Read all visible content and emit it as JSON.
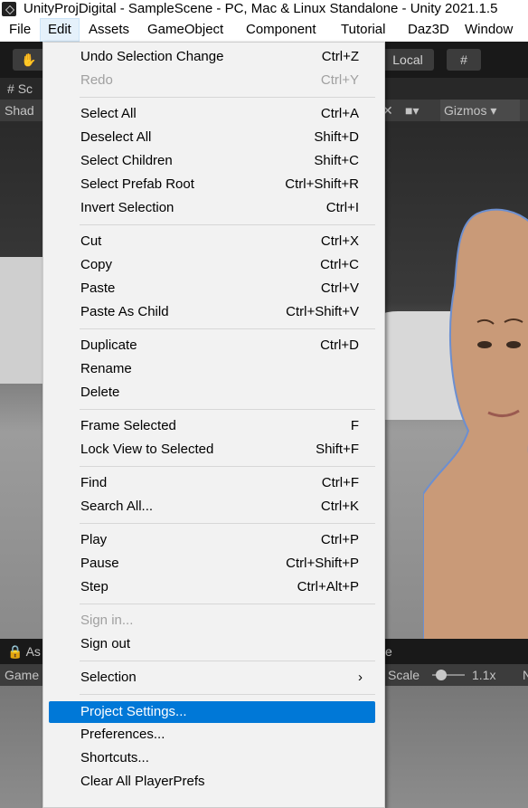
{
  "window": {
    "title": "UnityProjDigital - SampleScene - PC, Mac & Linux Standalone - Unity 2021.1.5"
  },
  "menubar": [
    "File",
    "Edit",
    "Assets",
    "GameObject",
    "Component",
    "Tutorial",
    "Daz3D",
    "Window"
  ],
  "editor": {
    "toolbar_local": "Local",
    "scene_tab": "Sc",
    "scene_shading": "Shad",
    "gizmos": "Gizmos",
    "assets_tab": "As",
    "game_tab_suffix": "e",
    "game_label": "Game",
    "scale_label": "Scale",
    "scale_value": "1.1x",
    "scale_level": 0.1
  },
  "menu": {
    "undo": {
      "label": "Undo Selection Change",
      "shortcut": "Ctrl+Z"
    },
    "redo": {
      "label": "Redo",
      "shortcut": "Ctrl+Y"
    },
    "select_all": {
      "label": "Select All",
      "shortcut": "Ctrl+A"
    },
    "deselect_all": {
      "label": "Deselect All",
      "shortcut": "Shift+D"
    },
    "select_children": {
      "label": "Select Children",
      "shortcut": "Shift+C"
    },
    "select_prefab_root": {
      "label": "Select Prefab Root",
      "shortcut": "Ctrl+Shift+R"
    },
    "invert_selection": {
      "label": "Invert Selection",
      "shortcut": "Ctrl+I"
    },
    "cut": {
      "label": "Cut",
      "shortcut": "Ctrl+X"
    },
    "copy": {
      "label": "Copy",
      "shortcut": "Ctrl+C"
    },
    "paste": {
      "label": "Paste",
      "shortcut": "Ctrl+V"
    },
    "paste_as_child": {
      "label": "Paste As Child",
      "shortcut": "Ctrl+Shift+V"
    },
    "duplicate": {
      "label": "Duplicate",
      "shortcut": "Ctrl+D"
    },
    "rename": {
      "label": "Rename",
      "shortcut": ""
    },
    "delete": {
      "label": "Delete",
      "shortcut": ""
    },
    "frame_selected": {
      "label": "Frame Selected",
      "shortcut": "F"
    },
    "lock_view": {
      "label": "Lock View to Selected",
      "shortcut": "Shift+F"
    },
    "find": {
      "label": "Find",
      "shortcut": "Ctrl+F"
    },
    "search_all": {
      "label": "Search All...",
      "shortcut": "Ctrl+K"
    },
    "play": {
      "label": "Play",
      "shortcut": "Ctrl+P"
    },
    "pause": {
      "label": "Pause",
      "shortcut": "Ctrl+Shift+P"
    },
    "step": {
      "label": "Step",
      "shortcut": "Ctrl+Alt+P"
    },
    "sign_in": {
      "label": "Sign in...",
      "shortcut": ""
    },
    "sign_out": {
      "label": "Sign out",
      "shortcut": ""
    },
    "selection": {
      "label": "Selection",
      "shortcut": ""
    },
    "project_settings": {
      "label": "Project Settings...",
      "shortcut": ""
    },
    "preferences": {
      "label": "Preferences...",
      "shortcut": ""
    },
    "shortcuts": {
      "label": "Shortcuts...",
      "shortcut": ""
    },
    "clear_playerprefs": {
      "label": "Clear All PlayerPrefs",
      "shortcut": ""
    }
  },
  "colors": {
    "highlight": "#0078d7",
    "menu_bg": "#f2f2f2",
    "disabled_text": "#a0a0a0"
  }
}
